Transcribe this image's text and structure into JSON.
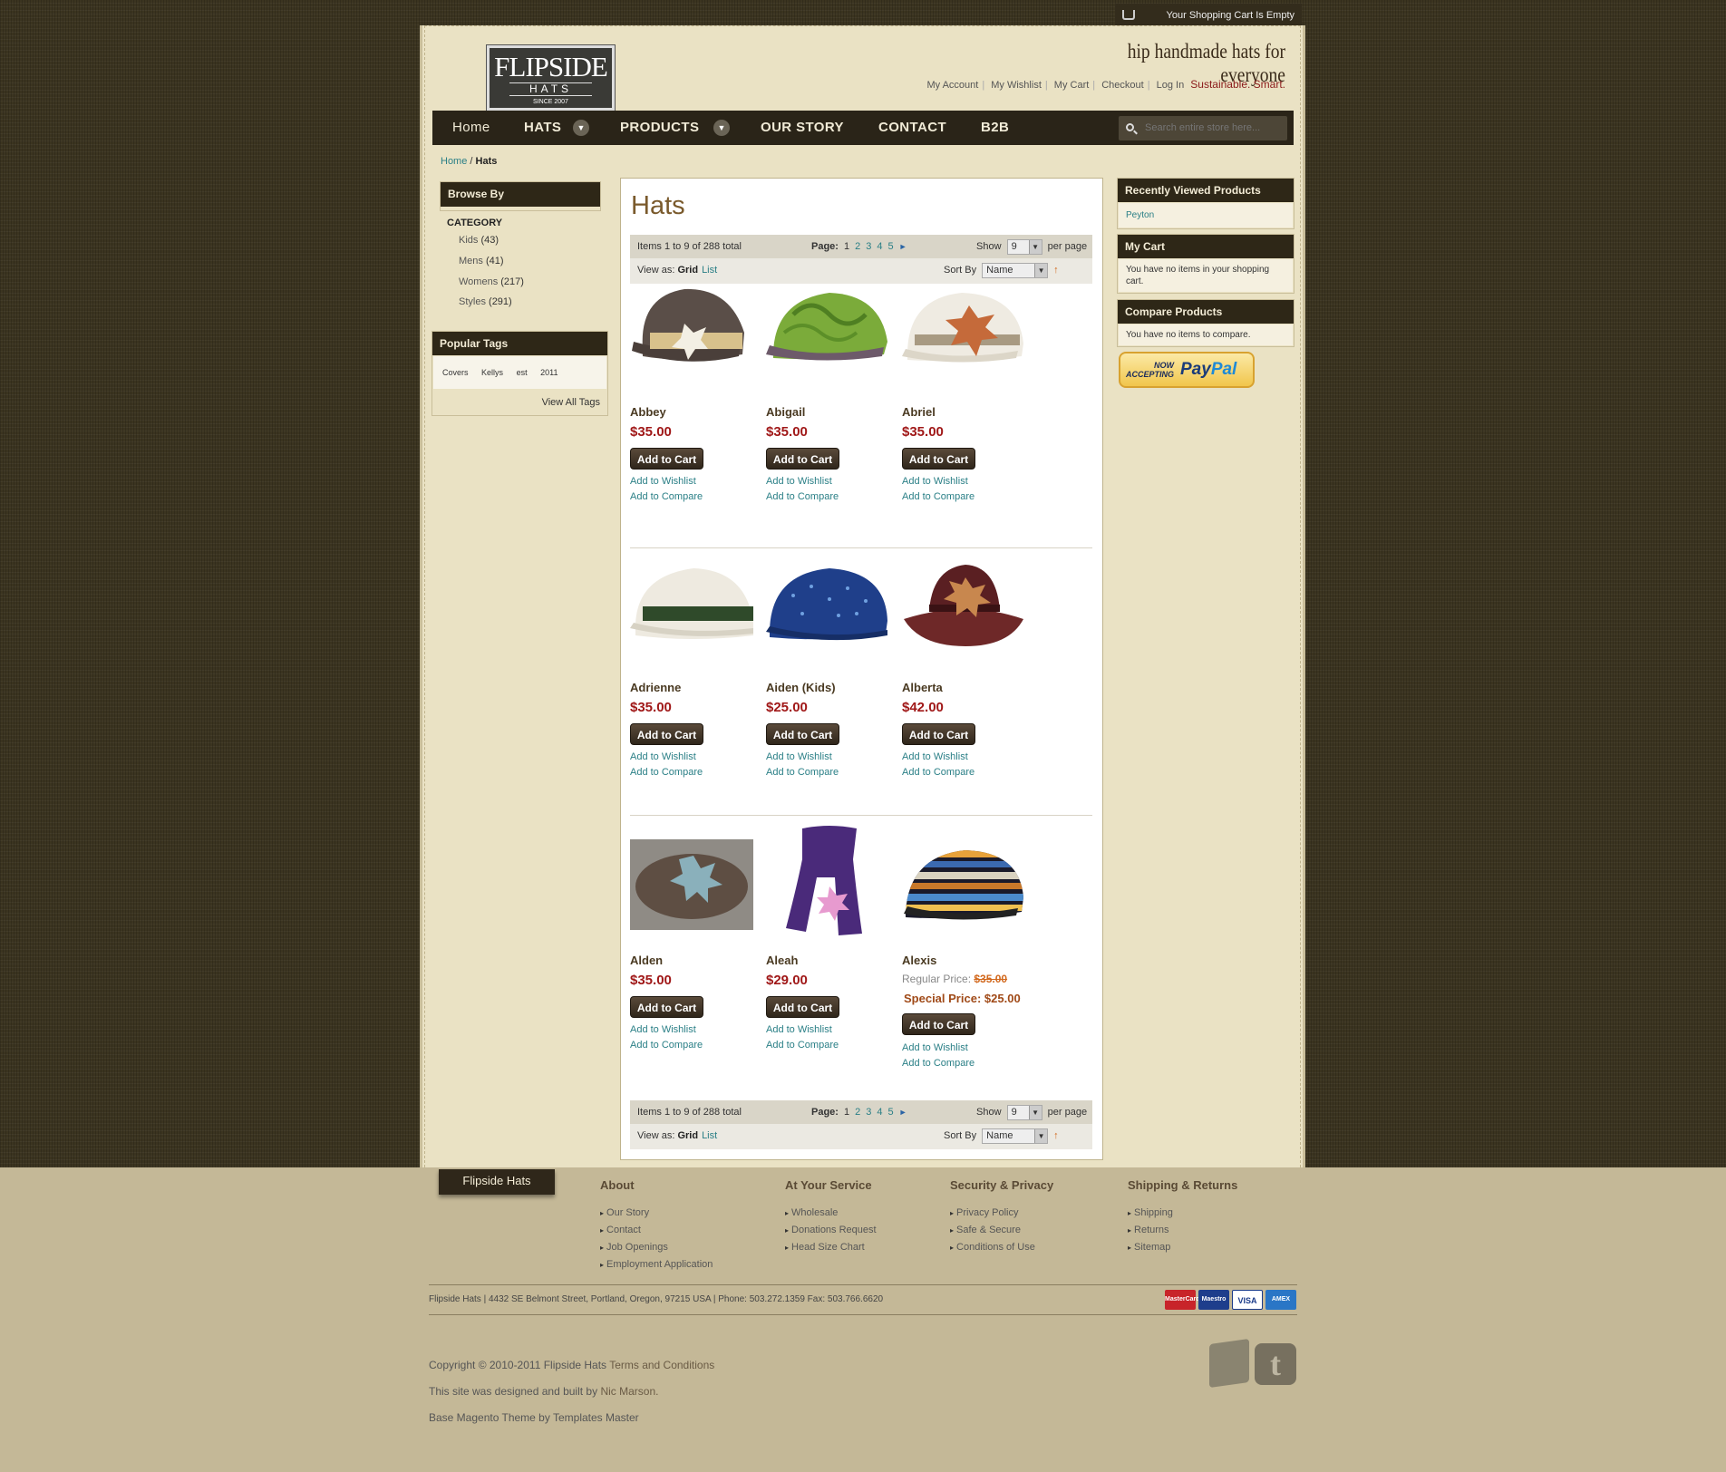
{
  "header": {
    "cart_status": "Your Shopping Cart Is Empty",
    "logo_text": "FLIPSIDE",
    "logo_sub": "HATS",
    "logo_since": "SINCE 2007",
    "tagline": "hip handmade hats for everyone",
    "links": [
      "My Account",
      "My Wishlist",
      "My Cart",
      "Checkout",
      "Log In"
    ],
    "slogan": "Sustainable. Smart."
  },
  "nav": {
    "items": [
      "Home",
      "HATS",
      "PRODUCTS",
      "OUR STORY",
      "CONTACT",
      "B2B"
    ],
    "search_placeholder": "Search entire store here..."
  },
  "breadcrumb": {
    "home": "Home",
    "sep": " / ",
    "current": "Hats"
  },
  "left": {
    "browse_title": "Browse By",
    "category_label": "CATEGORY",
    "categories": [
      {
        "name": "Kids",
        "count": "(43)"
      },
      {
        "name": "Mens",
        "count": "(41)"
      },
      {
        "name": "Womens",
        "count": "(217)"
      },
      {
        "name": "Styles",
        "count": "(291)"
      }
    ],
    "tags_title": "Popular Tags",
    "tags": [
      "Covers",
      "Kellys",
      "est",
      "2011"
    ],
    "view_all": "View All Tags"
  },
  "main": {
    "title": "Hats",
    "items_text": "Items 1 to 9 of 288 total",
    "page_label": "Page:",
    "pages": [
      "1",
      "2",
      "3",
      "4",
      "5"
    ],
    "show_label": "Show",
    "per_page_value": "9",
    "per_page_label": "per page",
    "view_label": "View as:",
    "view_grid": "Grid",
    "view_list": "List",
    "sort_label": "Sort By",
    "sort_value": "Name",
    "sort_arrow": "↑",
    "add_to_cart": "Add to Cart",
    "add_to_wishlist": "Add to Wishlist",
    "add_to_compare": "Add to Compare",
    "products": [
      {
        "name": "Abbey",
        "price": "$35.00"
      },
      {
        "name": "Abigail",
        "price": "$35.00"
      },
      {
        "name": "Abriel",
        "price": "$35.00"
      },
      {
        "name": "Adrienne",
        "price": "$35.00"
      },
      {
        "name": "Aiden (Kids)",
        "price": "$25.00"
      },
      {
        "name": "Alberta",
        "price": "$42.00"
      },
      {
        "name": "Alden",
        "price": "$35.00"
      },
      {
        "name": "Aleah",
        "price": "$29.00"
      },
      {
        "name": "Alexis",
        "regular_label": "Regular Price:",
        "regular_price": "$35.00",
        "special_label": "Special Price:",
        "special_price": "$25.00"
      }
    ]
  },
  "right": {
    "recent_title": "Recently Viewed Products",
    "recent_item": "Peyton",
    "cart_title": "My Cart",
    "cart_text": "You have no items in your shopping cart.",
    "compare_title": "Compare Products",
    "compare_text": "You have no items to compare.",
    "paypal_now": "NOW",
    "paypal_accepting": "ACCEPTING",
    "paypal_logo_a": "Pay",
    "paypal_logo_b": "Pal"
  },
  "footer": {
    "tab": "Flipside Hats",
    "cols": [
      {
        "title": "About",
        "links": [
          "Our Story",
          "Contact",
          "Job Openings",
          "Employment Application"
        ]
      },
      {
        "title": "At Your Service",
        "links": [
          "Wholesale",
          "Donations Request",
          "Head Size Chart"
        ]
      },
      {
        "title": "Security & Privacy",
        "links": [
          "Privacy Policy",
          "Safe & Secure",
          "Conditions of Use"
        ]
      },
      {
        "title": "Shipping & Returns",
        "links": [
          "Shipping",
          "Returns",
          "Sitemap"
        ]
      }
    ],
    "address": "Flipside Hats | 4432 SE Belmont Street, Portland, Oregon, 97215 USA | Phone: 503.272.1359 Fax: 503.766.6620",
    "cards": [
      "MasterCard",
      "Maestro",
      "VISA",
      "AMEX"
    ],
    "copyright": "Copyright © 2010-2011 Flipside Hats",
    "terms": "Terms and Conditions",
    "designed": "This site was designed and built by",
    "designer": "Nic Marson.",
    "theme": "Base Magento Theme by Templates Master",
    "social_t": "t"
  },
  "colors": {
    "nav_bg": "#2a2418",
    "price": "#a01818",
    "link": "#2a7f86",
    "footer_bg": "#c4b897"
  }
}
